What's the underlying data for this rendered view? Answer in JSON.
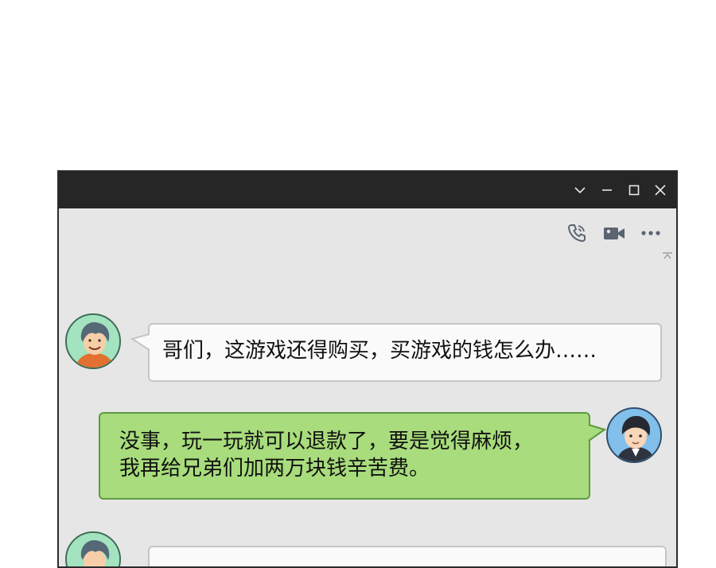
{
  "window": {
    "controls": [
      "chevron-down-icon",
      "minimize-icon",
      "maximize-icon",
      "close-icon"
    ],
    "toolbar": [
      "voice-call-icon",
      "video-call-icon",
      "more-icon"
    ]
  },
  "messages": [
    {
      "side": "left",
      "text": "哥们，这游戏还得购买，买游戏的钱怎么办……"
    },
    {
      "side": "right",
      "line1": "没事，玩一玩就可以退款了，要是觉得麻烦，",
      "line2": "我再给兄弟们加两万块钱辛苦费。"
    }
  ],
  "colors": {
    "titlebar": "#262626",
    "chat_bg": "#e6e6e6",
    "bubble_left": "#fafafa",
    "bubble_right": "#a8dc7c"
  }
}
